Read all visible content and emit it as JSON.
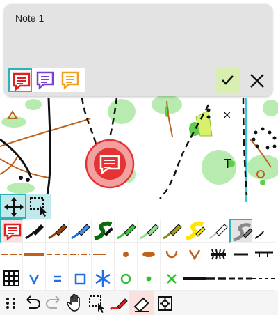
{
  "note": {
    "text": "Note 1"
  },
  "note_icons": [
    {
      "name": "note-red-icon",
      "color": "#e02020",
      "selected": true
    },
    {
      "name": "note-purple-icon",
      "color": "#7a3fd6",
      "selected": false
    },
    {
      "name": "note-orange-icon",
      "color": "#f0a020",
      "selected": false
    }
  ],
  "colors": {
    "accent": "#2bb3b8",
    "confirm_bg": "#d9efb1",
    "map_green": "#b8ebb0",
    "map_brown": "#c0601a",
    "marker_red": "#e53333"
  }
}
